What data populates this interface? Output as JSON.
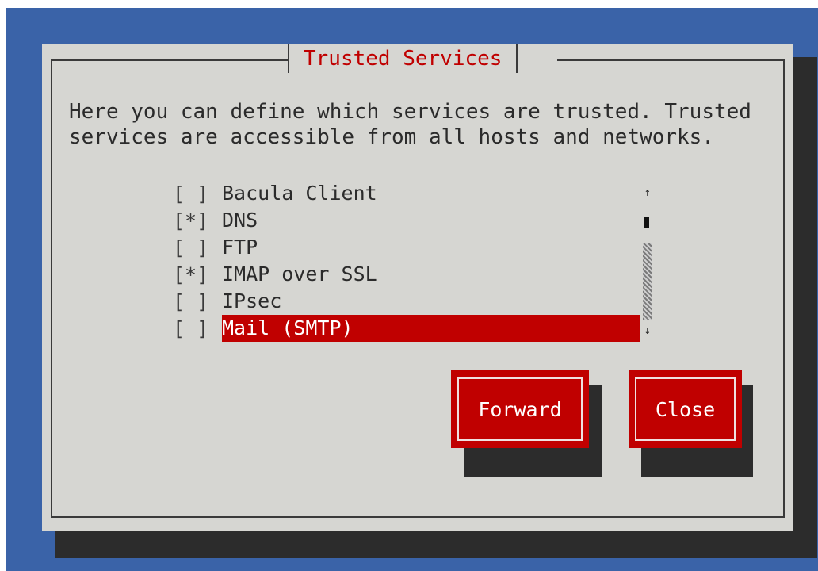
{
  "dialog": {
    "title": "Trusted Services",
    "description": "Here you can define which services are trusted. Trusted\nservices are accessible from all hosts and networks."
  },
  "services": [
    {
      "checkbox": "[ ]",
      "label": "Bacula Client",
      "checked": false,
      "selected": false
    },
    {
      "checkbox": "[*]",
      "label": "DNS",
      "checked": true,
      "selected": false
    },
    {
      "checkbox": "[ ]",
      "label": "FTP",
      "checked": false,
      "selected": false
    },
    {
      "checkbox": "[*]",
      "label": "IMAP over SSL",
      "checked": true,
      "selected": false
    },
    {
      "checkbox": "[ ]",
      "label": "IPsec",
      "checked": false,
      "selected": false
    },
    {
      "checkbox": "[ ]",
      "label": "Mail (SMTP)",
      "checked": false,
      "selected": true
    }
  ],
  "scrollbar": {
    "up_arrow": "↑",
    "down_arrow": "↓"
  },
  "buttons": {
    "forward": "Forward",
    "close": "Close"
  },
  "colors": {
    "background": "#3a63a8",
    "dialog": "#d6d6d2",
    "accent": "#c00000",
    "shadow": "#2c2c2c"
  }
}
